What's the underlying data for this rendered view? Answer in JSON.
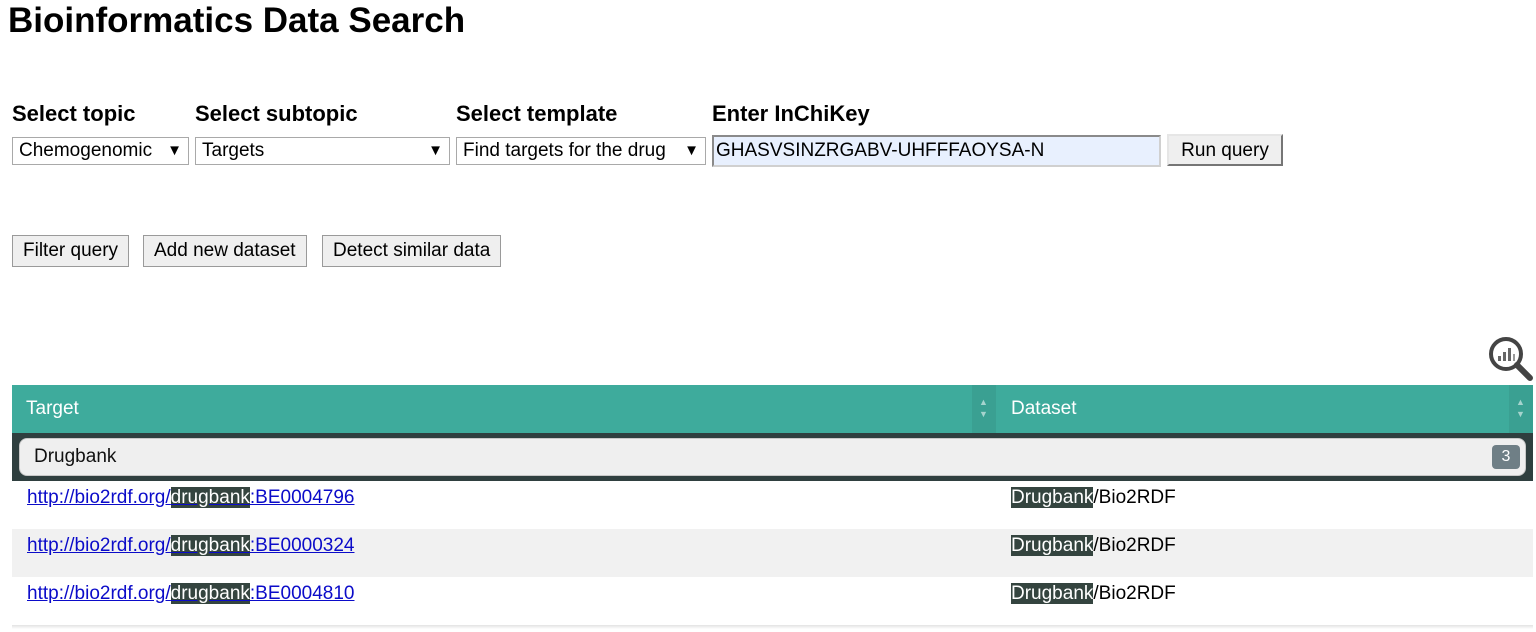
{
  "page": {
    "title": "Bioinformatics Data Search"
  },
  "form": {
    "topic": {
      "label": "Select topic",
      "value": "Chemogenomic"
    },
    "subtopic": {
      "label": "Select subtopic",
      "value": "Targets"
    },
    "template": {
      "label": "Select template",
      "value": "Find targets for the drug"
    },
    "inchikey": {
      "label": "Enter InChiKey",
      "value": "GHASVSINZRGABV-UHFFFAOYSA-N"
    },
    "run_label": "Run query"
  },
  "actions": {
    "filter_label": "Filter query",
    "add_dataset_label": "Add new dataset",
    "detect_similar_label": "Detect similar data"
  },
  "table": {
    "columns": [
      "Target",
      "Dataset"
    ],
    "group": {
      "name": "Drugbank",
      "count": "3"
    },
    "rows": [
      {
        "target_prefix": "http://bio2rdf.org/",
        "target_highlight": "drugbank",
        "target_suffix": ":BE0004796",
        "dataset_highlight": "Drugbank",
        "dataset_suffix": "/Bio2RDF"
      },
      {
        "target_prefix": "http://bio2rdf.org/",
        "target_highlight": "drugbank",
        "target_suffix": ":BE0000324",
        "dataset_highlight": "Drugbank",
        "dataset_suffix": "/Bio2RDF"
      },
      {
        "target_prefix": "http://bio2rdf.org/",
        "target_highlight": "drugbank",
        "target_suffix": ":BE0004810",
        "dataset_highlight": "Drugbank",
        "dataset_suffix": "/Bio2RDF"
      }
    ]
  },
  "icons": {
    "magnifier": "chart-magnifier-icon",
    "dropdown": "dropdown-arrow-icon",
    "sort": "sort-arrows-icon"
  },
  "colors": {
    "header": "#3eab9c",
    "group_bar": "#2f3f3f",
    "highlight": "#34443f",
    "link": "#0b0bc9",
    "input_bg": "#e8f0fe"
  }
}
